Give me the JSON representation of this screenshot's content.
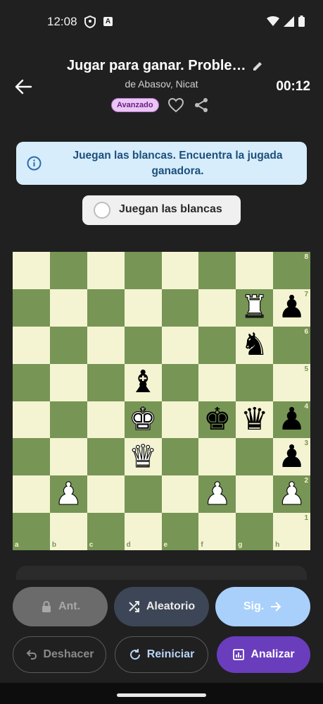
{
  "status_bar": {
    "time": "12:08",
    "a_badge": "A"
  },
  "header": {
    "title": "Jugar para ganar. Proble…",
    "author": "de Abasov, Nicat",
    "timer": "00:12",
    "difficulty_badge": "Avanzado"
  },
  "info_banner": {
    "text": "Juegan las blancas. Encuentra la jugada ganadora."
  },
  "turn_chip": {
    "label": "Juegan las blancas"
  },
  "board": {
    "files": [
      "a",
      "b",
      "c",
      "d",
      "e",
      "f",
      "g",
      "h"
    ],
    "ranks": [
      "8",
      "7",
      "6",
      "5",
      "4",
      "3",
      "2",
      "1"
    ],
    "pieces": [
      {
        "square": "g7",
        "glyph": "♜",
        "color": "white"
      },
      {
        "square": "h7",
        "glyph": "♟",
        "color": "black"
      },
      {
        "square": "g6",
        "glyph": "♞",
        "color": "black"
      },
      {
        "square": "d5",
        "glyph": "♝",
        "color": "black"
      },
      {
        "square": "d4",
        "glyph": "♚",
        "color": "white"
      },
      {
        "square": "f4",
        "glyph": "♚",
        "color": "black"
      },
      {
        "square": "g4",
        "glyph": "♛",
        "color": "black"
      },
      {
        "square": "h4",
        "glyph": "♟",
        "color": "black"
      },
      {
        "square": "d3",
        "glyph": "♛",
        "color": "white"
      },
      {
        "square": "h3",
        "glyph": "♟",
        "color": "black"
      },
      {
        "square": "b2",
        "glyph": "♟",
        "color": "white"
      },
      {
        "square": "f2",
        "glyph": "♟",
        "color": "white"
      },
      {
        "square": "h2",
        "glyph": "♟",
        "color": "white"
      }
    ]
  },
  "buttons": {
    "prev": "Ant.",
    "random": "Aleatorio",
    "next": "Sig.",
    "undo": "Deshacer",
    "reset": "Reiniciar",
    "analyze": "Analizar"
  },
  "colors": {
    "light_square": "#f4f4d2",
    "dark_square": "#779555",
    "analyze_button": "#6a3dbd",
    "next_button": "#a8d0fb",
    "info_banner": "#d7edfb",
    "badge": "#e9c6f3"
  }
}
